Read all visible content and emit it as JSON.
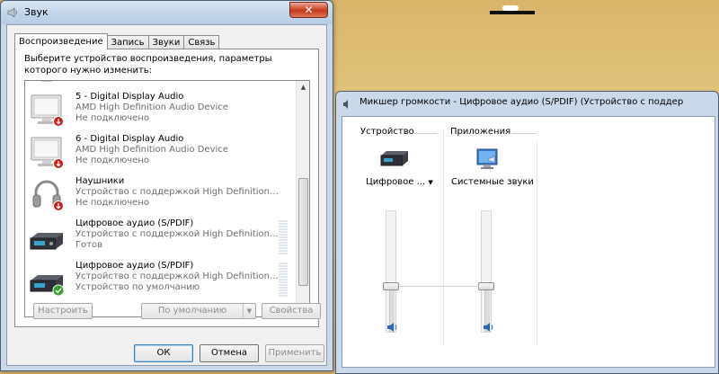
{
  "sound_dialog": {
    "title": "Звук",
    "close_label": "✕",
    "tabs": [
      {
        "label": "Воспроизведение",
        "active": true
      },
      {
        "label": "Запись",
        "active": false
      },
      {
        "label": "Звуки",
        "active": false
      },
      {
        "label": "Связь",
        "active": false
      }
    ],
    "instructions": "Выберите устройство воспроизведения, параметры которого нужно изменить:",
    "devices": [
      {
        "name": "5 - Digital Display Audio",
        "description": "AMD High Definition Audio Device",
        "status": "Не подключено",
        "icon": "monitor-icon",
        "badge": "disconnected-badge-icon"
      },
      {
        "name": "6 - Digital Display Audio",
        "description": "AMD High Definition Audio Device",
        "status": "Не подключено",
        "icon": "monitor-icon",
        "badge": "disconnected-badge-icon"
      },
      {
        "name": "Наушники",
        "description": "Устройство с поддержкой High Definition Au...",
        "status": "Не подключено",
        "icon": "headphones-icon",
        "badge": "disconnected-badge-icon"
      },
      {
        "name": "Цифровое аудио (S/PDIF)",
        "description": "Устройство с поддержкой High Definition Au...",
        "status": "Готов",
        "icon": "digital-audio-icon",
        "badge": ""
      },
      {
        "name": "Цифровое аудио (S/PDIF)",
        "description": "Устройство с поддержкой High Definition Au...",
        "status": "Устройство по умолчанию",
        "icon": "digital-audio-icon",
        "badge": "default-check-icon"
      }
    ],
    "buttons": {
      "configure": "Настроить",
      "set_default": "По умолчанию",
      "properties": "Свойства",
      "ok": "ОК",
      "cancel": "Отмена",
      "apply": "Применить"
    }
  },
  "mixer": {
    "title": "Микшер громкости - Цифровое аудио (S/PDIF) (Устройство с поддерж...",
    "device_group_label": "Устройство",
    "apps_group_label": "Приложения",
    "device_label": "Цифровое ...",
    "app_label": "Системные звуки",
    "device_volume": 0.37,
    "app_volume": 0.37
  }
}
